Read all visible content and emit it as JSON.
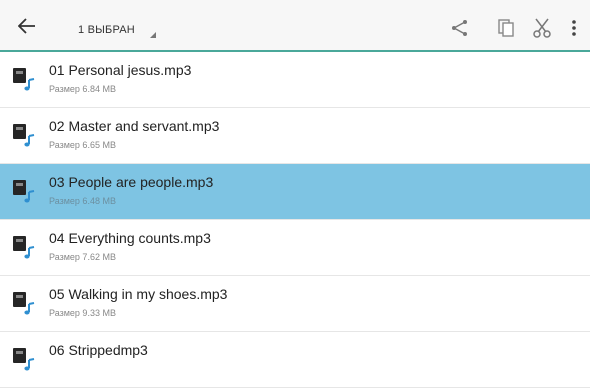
{
  "toolbar": {
    "selection_label": "1 ВЫБРАН",
    "icons": {
      "back": "arrow-left-icon",
      "share": "share-icon",
      "copy": "copy-icon",
      "cut": "scissors-icon",
      "more": "more-vertical-icon"
    }
  },
  "colors": {
    "accent": "#4aa89a",
    "selected_row": "#7ec4e3",
    "icon_blue": "#2f8fd0"
  },
  "files": [
    {
      "name": "01 Personal jesus.mp3",
      "size": "Размер 6.84 MB",
      "selected": false
    },
    {
      "name": "02 Master and servant.mp3",
      "size": "Размер 6.65 MB",
      "selected": false
    },
    {
      "name": "03 People are people.mp3",
      "size": "Размер 6.48 MB",
      "selected": true
    },
    {
      "name": "04 Everything counts.mp3",
      "size": "Размер 7.62 MB",
      "selected": false
    },
    {
      "name": "05 Walking in my shoes.mp3",
      "size": "Размер 9.33 MB",
      "selected": false
    },
    {
      "name": "06 Strippedmp3",
      "size": "",
      "selected": false
    }
  ]
}
